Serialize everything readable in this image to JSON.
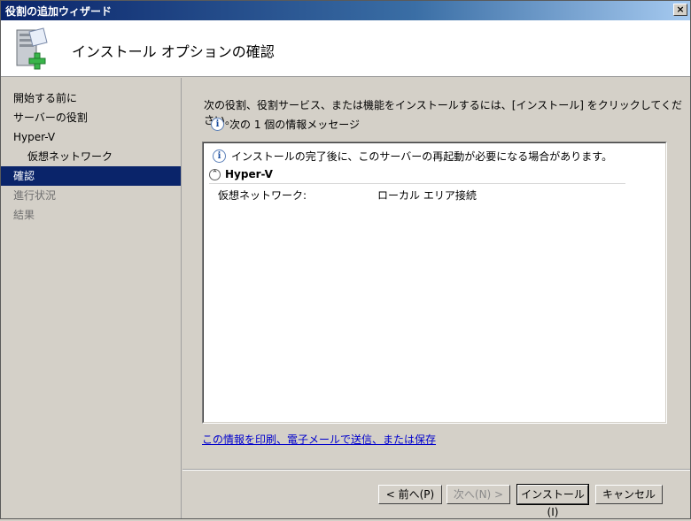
{
  "window": {
    "title": "役割の追加ウィザード",
    "close": "×"
  },
  "header": {
    "title": "インストール オプションの確認"
  },
  "sidebar": {
    "items": [
      {
        "label": "開始する前に",
        "state": "normal",
        "sub": false
      },
      {
        "label": "サーバーの役割",
        "state": "normal",
        "sub": false
      },
      {
        "label": "Hyper-V",
        "state": "normal",
        "sub": false
      },
      {
        "label": "仮想ネットワーク",
        "state": "normal",
        "sub": true
      },
      {
        "label": "確認",
        "state": "active",
        "sub": false
      },
      {
        "label": "進行状況",
        "state": "disabled",
        "sub": false
      },
      {
        "label": "結果",
        "state": "disabled",
        "sub": false
      }
    ]
  },
  "main": {
    "intro": "次の役割、役割サービス、または機能をインストールするには、[インストール] をクリックしてください。",
    "message_count": "次の 1 個の情報メッセージ",
    "notice": "インストールの完了後に、このサーバーの再起動が必要になる場合があります。",
    "section": {
      "title": "Hyper-V",
      "collapse_glyph": "⌃"
    },
    "row": {
      "key": "仮想ネットワーク:",
      "value": "ローカル エリア接続"
    },
    "link": "この情報を印刷、電子メールで送信、または保存",
    "info_glyph": "i"
  },
  "buttons": {
    "prev": "< 前へ(P)",
    "next": "次へ(N) >",
    "install": "インストール(I)",
    "cancel": "キャンセル"
  },
  "colors": {
    "titlebar": "#0a246a",
    "active": "#0a246a",
    "link": "#0000cc",
    "icon_plus": "#39b54a"
  }
}
